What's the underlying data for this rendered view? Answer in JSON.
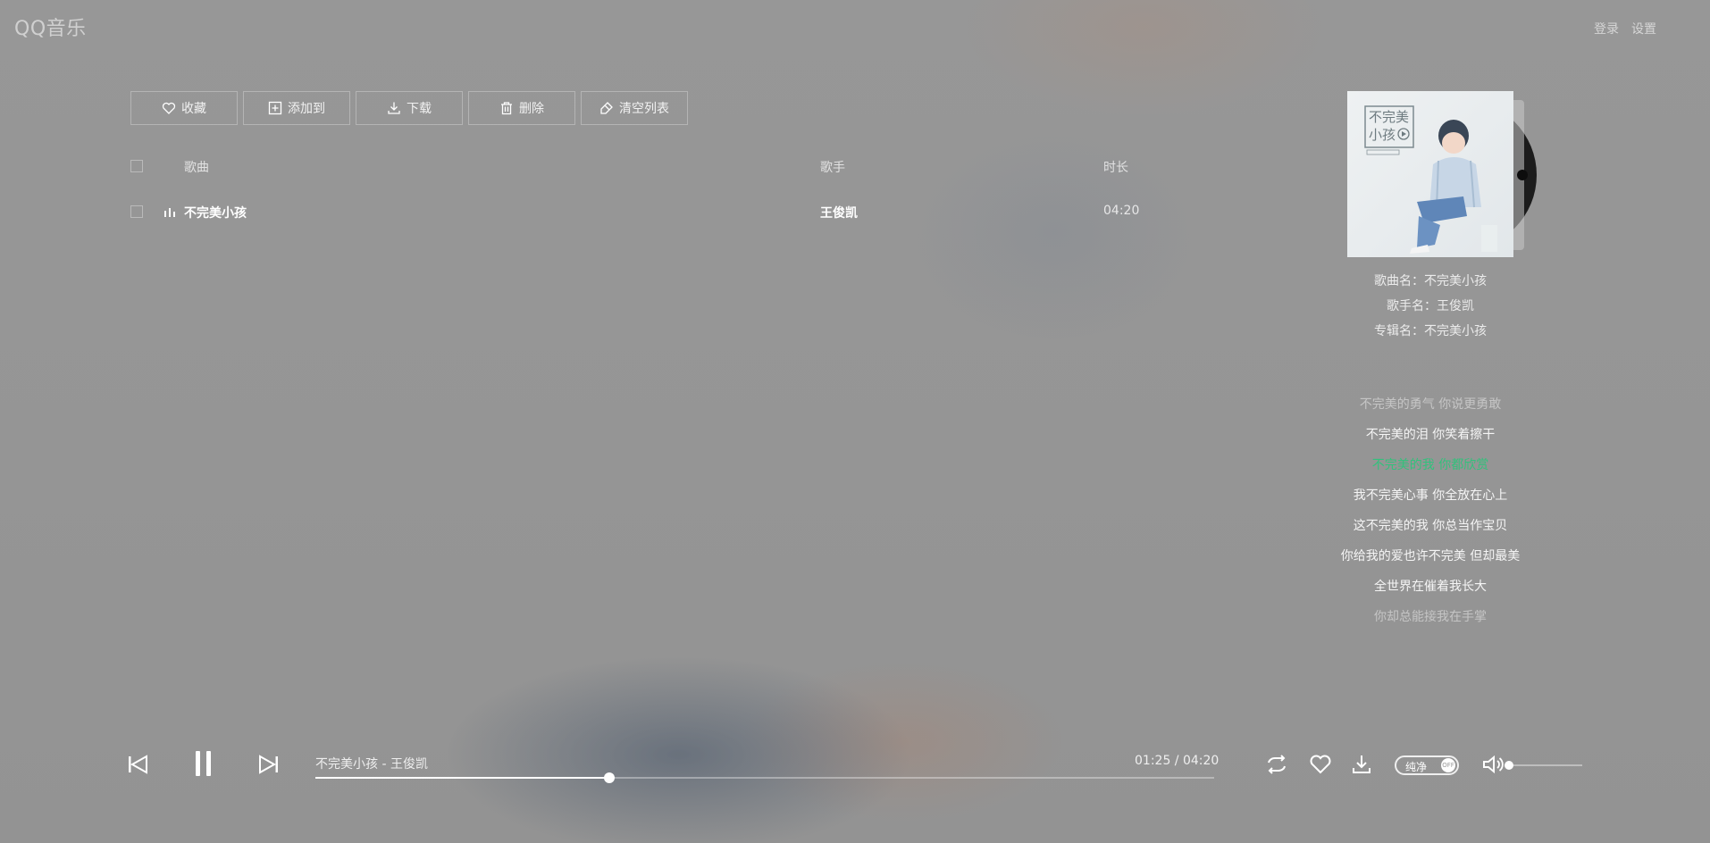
{
  "header": {
    "logo": "QQ音乐",
    "login": "登录",
    "settings": "设置"
  },
  "toolbar": [
    {
      "label": "收藏",
      "icon": "heart-icon"
    },
    {
      "label": "添加到",
      "icon": "plus-square-icon"
    },
    {
      "label": "下载",
      "icon": "download-icon"
    },
    {
      "label": "删除",
      "icon": "trash-icon"
    },
    {
      "label": "清空列表",
      "icon": "broom-icon"
    }
  ],
  "list": {
    "headers": {
      "song": "歌曲",
      "singer": "歌手",
      "duration": "时长"
    },
    "rows": [
      {
        "name": "不完美小孩",
        "singer": "王俊凯",
        "duration": "04:20",
        "playing": true
      }
    ]
  },
  "now_playing": {
    "cover_title_line1": "不完美",
    "cover_title_line2": "小孩",
    "song_line": "歌曲名：不完美小孩",
    "singer_line": "歌手名：王俊凯",
    "album_line": "专辑名：不完美小孩"
  },
  "lyrics": [
    {
      "text": "不完美的勇气 你说更勇敢",
      "state": "dim"
    },
    {
      "text": "不完美的泪 你笑着擦干",
      "state": "normal"
    },
    {
      "text": "不完美的我 你都欣赏",
      "state": "active"
    },
    {
      "text": "我不完美心事 你全放在心上",
      "state": "normal"
    },
    {
      "text": "这不完美的我 你总当作宝贝",
      "state": "normal"
    },
    {
      "text": "你给我的爱也许不完美 但却最美",
      "state": "normal"
    },
    {
      "text": "全世界在催着我长大",
      "state": "normal"
    },
    {
      "text": "你却总能接我在手掌",
      "state": "dim"
    }
  ],
  "player": {
    "track": "不完美小孩 - 王俊凯",
    "time_display": "01:25 / 04:20",
    "progress": 0.327,
    "pure_mode_label": "纯净",
    "pure_mode_state": "OFF",
    "volume": 0.0,
    "accent_color": "#31c27c"
  }
}
